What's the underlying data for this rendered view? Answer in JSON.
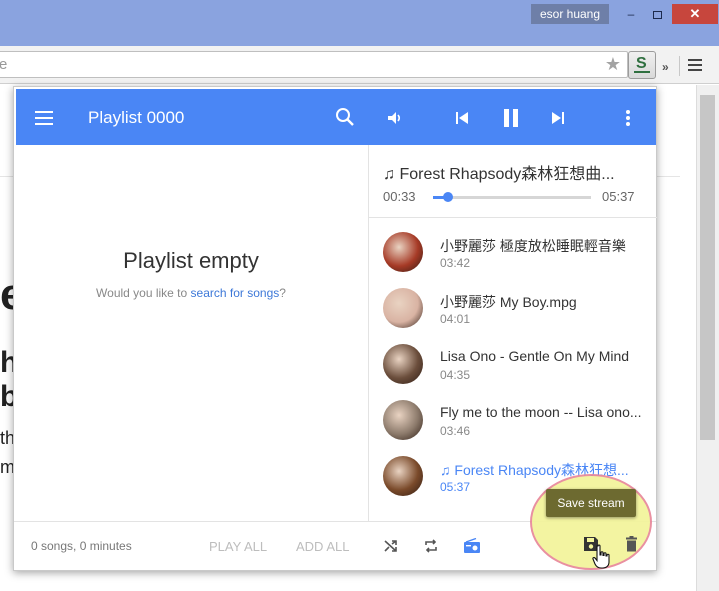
{
  "browser": {
    "user_name": "esor huang",
    "address_text": "e",
    "window_min": "–",
    "window_close": "✕",
    "more_extensions": "»"
  },
  "popup": {
    "title": "Playlist 0000",
    "empty": {
      "title": "Playlist empty",
      "prefix": "Would you like to",
      "link": "search for songs",
      "suffix": "?"
    },
    "now_playing": {
      "title": "♫ Forest Rhapsody森林狂想曲...",
      "elapsed": "00:33",
      "total": "05:37",
      "progress": 0.098
    },
    "songs": [
      {
        "title": "小野麗莎 極度放松睡眠輕音樂",
        "duration": "03:42",
        "active": false,
        "thumb_color": "#a63a26"
      },
      {
        "title": "小野麗莎 My Boy.mpg",
        "duration": "04:01",
        "active": false,
        "thumb_color": "#d9b3a3"
      },
      {
        "title": "Lisa Ono - Gentle On My Mind",
        "duration": "04:35",
        "active": false,
        "thumb_color": "#6b4e3c"
      },
      {
        "title": "Fly me to the moon -- Lisa ono...",
        "duration": "03:46",
        "active": false,
        "thumb_color": "#8c7a6b"
      },
      {
        "title": "♫ Forest Rhapsody森林狂想...",
        "duration": "05:37",
        "active": true,
        "thumb_color": "#7a4a2a"
      }
    ],
    "footer": {
      "count": "0 songs, 0 minutes",
      "play_all": "PLAY ALL",
      "add_all": "ADD ALL"
    },
    "tooltip": "Save stream"
  },
  "colors": {
    "accent": "#4a86f5",
    "tooltip_bg": "#6d6a30",
    "highlight": "#f3f49a"
  },
  "background_fragments": [
    "e",
    "he",
    "b",
    "th",
    "ma"
  ]
}
